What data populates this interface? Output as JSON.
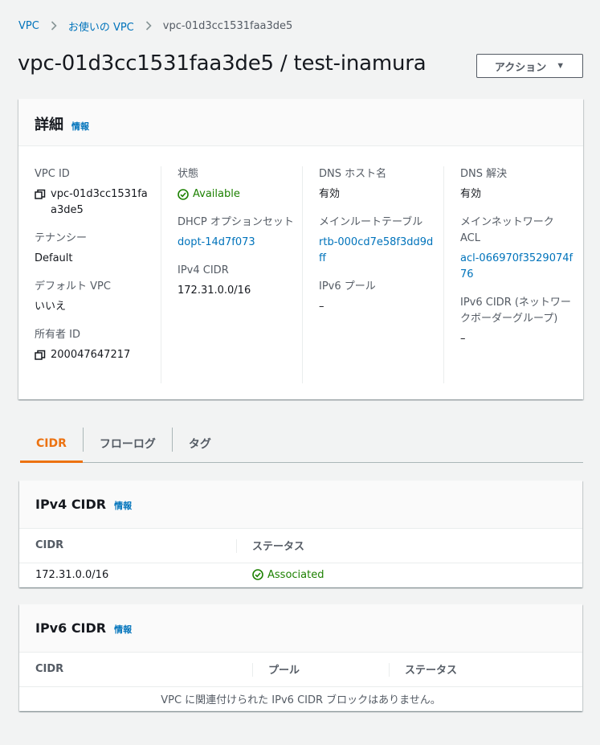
{
  "breadcrumb": {
    "items": [
      "VPC",
      "お使いの VPC"
    ],
    "current": "vpc-01d3cc1531faa3de5"
  },
  "page": {
    "title": "vpc-01d3cc1531faa3de5 / test-inamura",
    "action_label": "アクション"
  },
  "details": {
    "title": "詳細",
    "info": "情報",
    "col1": {
      "vpc_id_label": "VPC ID",
      "vpc_id_value": "vpc-01d3cc1531faa3de5",
      "tenancy_label": "テナンシー",
      "tenancy_value": "Default",
      "default_vpc_label": "デフォルト VPC",
      "default_vpc_value": "いいえ",
      "owner_label": "所有者 ID",
      "owner_value": "200047647217"
    },
    "col2": {
      "state_label": "状態",
      "state_value": "Available",
      "dhcp_label": "DHCP オプションセット",
      "dhcp_value": "dopt-14d7f073",
      "ipv4_label": "IPv4 CIDR",
      "ipv4_value": "172.31.0.0/16"
    },
    "col3": {
      "dns_host_label": "DNS ホスト名",
      "dns_host_value": "有効",
      "main_rt_label": "メインルートテーブル",
      "main_rt_value": "rtb-000cd7e58f3dd9dff",
      "ipv6_pool_label": "IPv6 プール",
      "ipv6_pool_value": "–"
    },
    "col4": {
      "dns_res_label": "DNS 解決",
      "dns_res_value": "有効",
      "main_acl_label": "メインネットワーク ACL",
      "main_acl_value": "acl-066970f3529074f76",
      "ipv6_cidr_label": "IPv6 CIDR (ネットワークボーダーグループ)",
      "ipv6_cidr_value": "–"
    }
  },
  "tabs": [
    "CIDR",
    "フローログ",
    "タグ"
  ],
  "ipv4_table": {
    "title": "IPv4 CIDR",
    "info": "情報",
    "headers": [
      "CIDR",
      "ステータス"
    ],
    "rows": [
      {
        "cidr": "172.31.0.0/16",
        "status": "Associated"
      }
    ]
  },
  "ipv6_table": {
    "title": "IPv6 CIDR",
    "info": "情報",
    "headers": [
      "CIDR",
      "プール",
      "ステータス"
    ],
    "empty": "VPC に関連付けられた IPv6 CIDR ブロックはありません。"
  },
  "colors": {
    "link": "#0073bb",
    "success": "#1d8102",
    "active_tab": "#ec7211",
    "background": "#f2f3f3"
  },
  "icons": {
    "copy": "copy-icon",
    "status": "check-circle-icon",
    "breadcrumb_separator": "chevron-right-icon",
    "dropdown": "caret-down-icon"
  }
}
